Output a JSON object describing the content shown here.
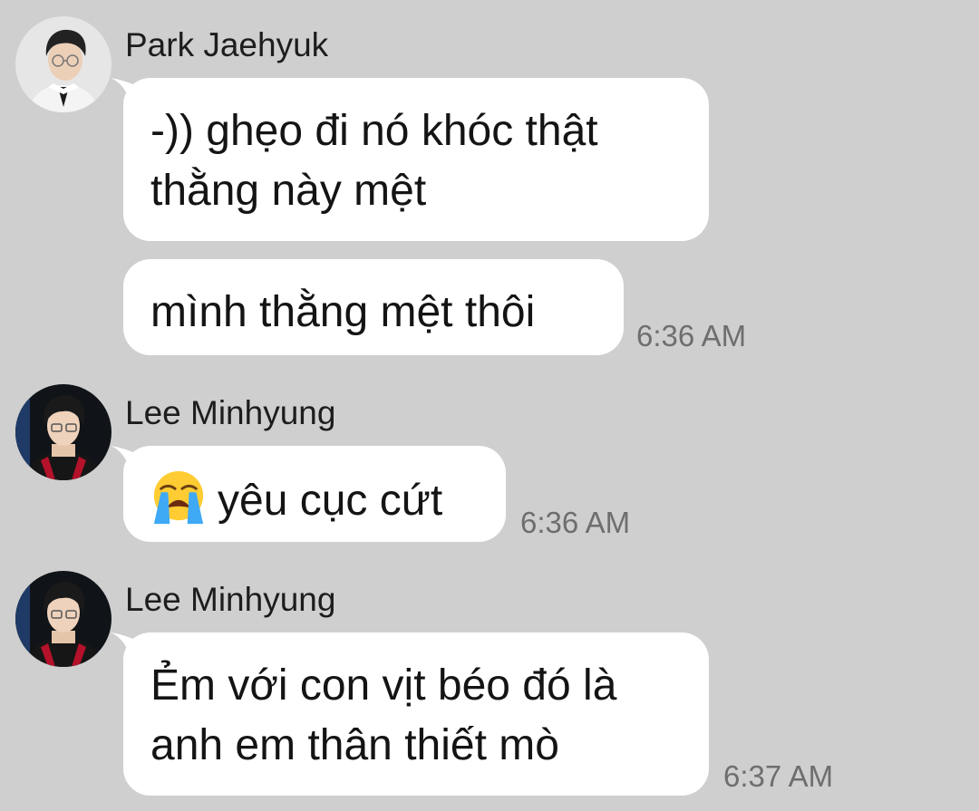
{
  "messages": [
    {
      "sender": "Park Jaehyuk",
      "lines": [
        "-)) ghẹo đi nó khóc thật",
        "thằng này mệt"
      ],
      "avatar_icon": "avatar-park-jaehyuk"
    },
    {
      "lines": [
        "mình thằng mệt thôi"
      ],
      "time": "6:36 AM"
    },
    {
      "sender": "Lee Minhyung",
      "emoji": "loudly-crying-face-icon",
      "text": "yêu cục cứt",
      "time": "6:36 AM",
      "avatar_icon": "avatar-lee-minhyung"
    },
    {
      "sender": "Lee Minhyung",
      "lines": [
        "Ẻm với con vịt béo đó là",
        "anh em thân thiết mò"
      ],
      "time": "6:37 AM",
      "avatar_icon": "avatar-lee-minhyung"
    }
  ],
  "colors": {
    "background": "#cfcfcf",
    "bubble": "#ffffff",
    "timestamp": "#6e6e6e"
  }
}
